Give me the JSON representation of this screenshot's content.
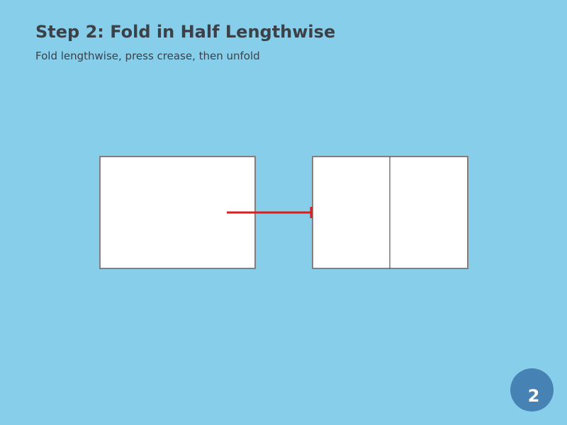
{
  "page": {
    "title": "Step 2: Fold in Half Lengthwise",
    "subtitle": "Fold lengthwise, press crease, then unfold",
    "step_number": "2"
  },
  "colors": {
    "background": "#87ceeb",
    "paper_fill": "#ffffff",
    "paper_border": "#808080",
    "crease_line": "#333333",
    "arrow": "#dd1c1c",
    "badge": "#4682b4",
    "text": "#3a4148"
  },
  "diagram": {
    "panels": [
      {
        "name": "flat-paper",
        "crease": false
      },
      {
        "name": "creased-paper",
        "crease": true
      }
    ],
    "arrow": {
      "from": "flat-paper",
      "to": "creased-paper"
    }
  }
}
